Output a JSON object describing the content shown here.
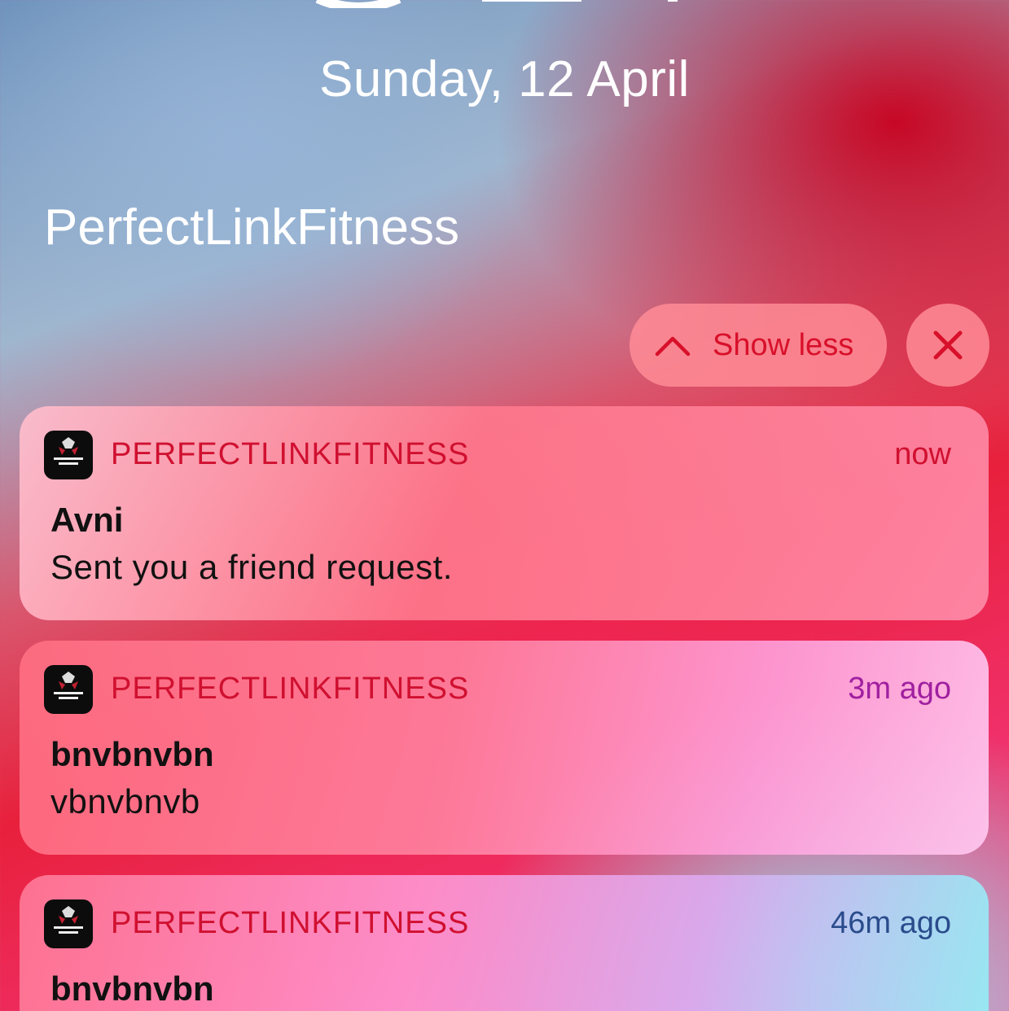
{
  "date": "Sunday, 12 April",
  "group": {
    "title": "PerfectLinkFitness",
    "show_less_label": "Show less",
    "show_less_icon": "chevron-up-icon",
    "close_icon": "close-icon"
  },
  "colors": {
    "accent": "#d8102a",
    "text_dark": "#111111"
  },
  "notifications": [
    {
      "app": "PERFECTLINKFITNESS",
      "time": "now",
      "title": "Avni",
      "body": "Sent you a friend request.",
      "icon": "app-logo-icon"
    },
    {
      "app": "PERFECTLINKFITNESS",
      "time": "3m ago",
      "title": "bnvbnvbn",
      "body": "vbnvbnvb",
      "icon": "app-logo-icon"
    },
    {
      "app": "PERFECTLINKFITNESS",
      "time": "46m ago",
      "title": "bnvbnvbn",
      "icon": "app-logo-icon"
    }
  ]
}
